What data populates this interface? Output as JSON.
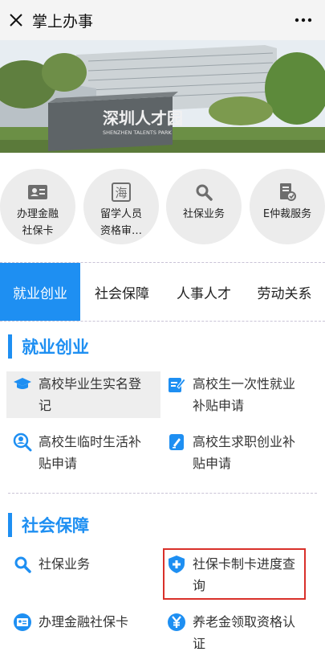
{
  "topbar": {
    "title": "掌上办事",
    "close_icon": "close-icon",
    "more_icon": "more-icon"
  },
  "banner": {
    "sign_cn": "深圳人才园",
    "sign_en": "SHENZHEN TALENTS PARK"
  },
  "shortcuts": [
    {
      "label": "办理金融\n社保卡",
      "icon": "id-card-icon"
    },
    {
      "label": "留学人员\n资格审…",
      "icon": "hai-icon",
      "glyph": "海"
    },
    {
      "label": "社保业务",
      "icon": "search-icon"
    },
    {
      "label": "E仲裁服务",
      "icon": "arbitration-icon"
    }
  ],
  "tabs": [
    {
      "label": "就业创业",
      "active": true
    },
    {
      "label": "社会保障",
      "active": false
    },
    {
      "label": "人事人才",
      "active": false
    },
    {
      "label": "劳动关系",
      "active": false
    }
  ],
  "sections": [
    {
      "title": "就业创业",
      "items": [
        {
          "label": "高校毕业生实名登\n记",
          "icon": "graduation-cap-icon"
        },
        {
          "label": "高校生一次性就业\n补贴申请",
          "icon": "edit-icon"
        },
        {
          "label": "高校生临时生活补\n贴申请",
          "icon": "person-search-icon"
        },
        {
          "label": "高校生求职创业补\n贴申请",
          "icon": "edit-doc-icon"
        }
      ]
    },
    {
      "title": "社会保障",
      "items": [
        {
          "label": "社保业务",
          "icon": "search-icon"
        },
        {
          "label": "社保卡制卡进度查\n询",
          "icon": "shield-plus-icon"
        },
        {
          "label": "办理金融社保卡",
          "icon": "id-card-icon"
        },
        {
          "label": "养老金领取资格认\n证",
          "icon": "yen-icon"
        }
      ]
    }
  ],
  "colors": {
    "accent": "#1e8ff2",
    "highlight_border": "#d9302a"
  }
}
